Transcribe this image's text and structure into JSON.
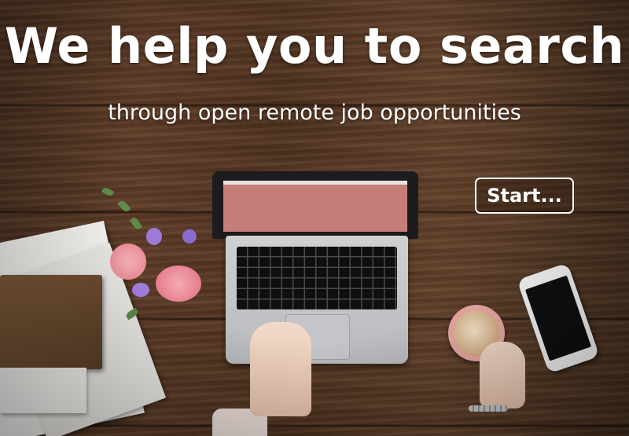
{
  "hero": {
    "headline": "We help you to search",
    "subheadline": "through open remote job opportunities",
    "start_label": "Start..."
  },
  "colors": {
    "text": "#ffffff",
    "button_border": "#ffffff",
    "wood": "#5b3a26",
    "laptop_screen": "#c57f78"
  },
  "icons": {
    "start": "none"
  }
}
